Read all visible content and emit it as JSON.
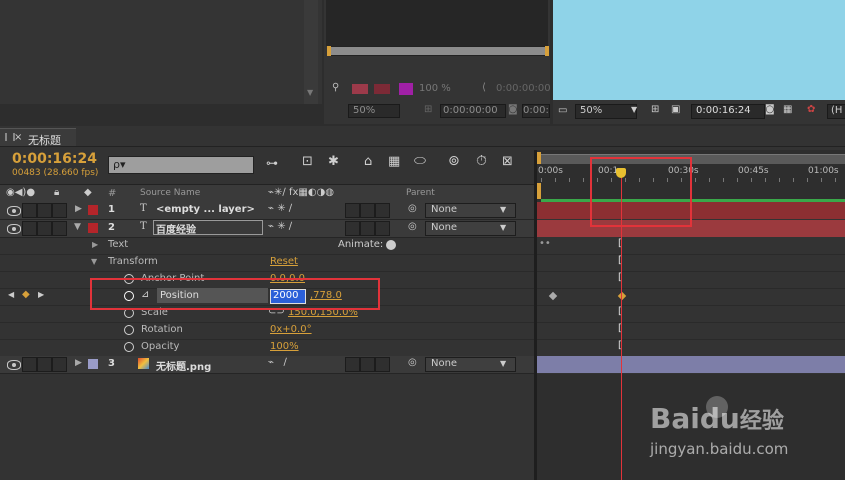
{
  "colors": {
    "accent": "#d7a03a",
    "red_label": "#b4252a",
    "lavender_label": "#9a9cc8",
    "highlight": "#e2333a",
    "sky": "#8fd3e8"
  },
  "footage_panel": {
    "zoom": "100 %",
    "timecode1": "0:00:00:00",
    "timecode2": "0:00:00:00",
    "timecode3": "0:00:00:00",
    "zoom_alt": "50%"
  },
  "comp_viewer": {
    "zoom": "50%",
    "timecode": "0:00:16:24",
    "view_btn": "(H"
  },
  "tab": {
    "title": "无标题"
  },
  "timeline": {
    "current_time": "0:00:16:24",
    "frame_info": "00483 (28.660 fps)",
    "search_placeholder": "ρ▾",
    "columns": {
      "num": "#",
      "source": "Source Name",
      "parent": "Parent"
    },
    "ruler": [
      "0:00s",
      "00:1",
      "00:30s",
      "00:45s",
      "01:00s"
    ]
  },
  "layers": [
    {
      "num": "1",
      "name": "<empty ... layer>",
      "parent": "None",
      "icon": "T"
    },
    {
      "num": "2",
      "name": "百度经验",
      "parent": "None",
      "icon": "T"
    },
    {
      "num": "3",
      "name": "无标题.png",
      "parent": "None",
      "icon": "image"
    }
  ],
  "properties": {
    "text": "Text",
    "animate": "Animate:",
    "transform": "Transform",
    "reset": "Reset",
    "anchor_point": {
      "label": "Anchor Point",
      "value": "0.0,0.0"
    },
    "position": {
      "label": "Position",
      "x": "2000",
      "y": ",778.0"
    },
    "scale": {
      "label": "Scale",
      "value": "150.0,150.0%"
    },
    "rotation": {
      "label": "Rotation",
      "value": "0x+0.0°"
    },
    "opacity": {
      "label": "Opacity",
      "value": "100%"
    }
  },
  "watermark": {
    "brand": "Baidu",
    "brand_cn": "经验",
    "url": "jingyan.baidu.com"
  }
}
